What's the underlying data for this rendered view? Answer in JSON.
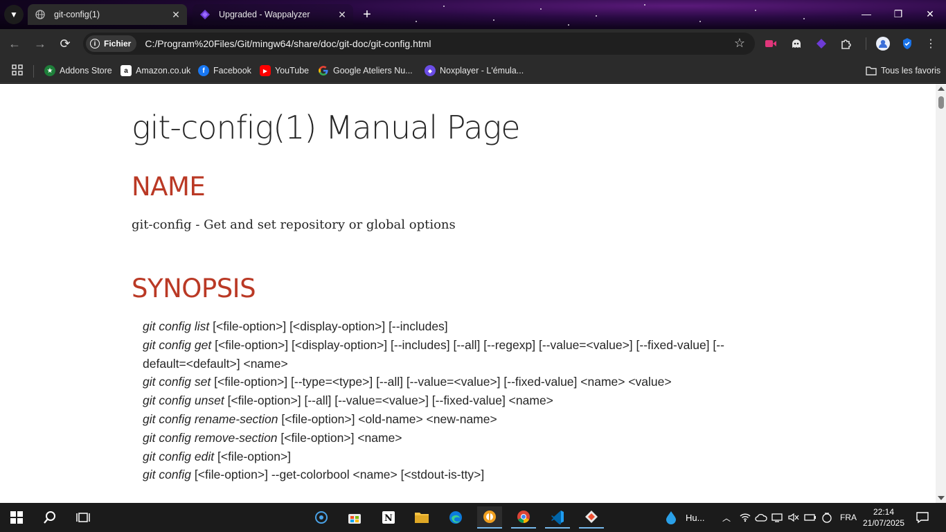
{
  "tabs": [
    {
      "title": "git-config(1)",
      "favicon": "globe-icon",
      "active": true
    },
    {
      "title": "Upgraded - Wappalyzer",
      "favicon": "wappalyzer-icon",
      "active": false
    }
  ],
  "window_controls": {
    "minimize": "—",
    "restore": "❐",
    "close": "✕"
  },
  "toolbar": {
    "security_chip": "Fichier",
    "url": "C:/Program%20Files/Git/mingw64/share/doc/git-doc/git-config.html"
  },
  "bookmarks": {
    "apps_icon": "apps-grid-icon",
    "items": [
      {
        "label": "Addons Store",
        "icon": "addons-store-icon",
        "color": "#1e7f3a"
      },
      {
        "label": "Amazon.co.uk",
        "icon": "amazon-icon",
        "color": "#ffffff"
      },
      {
        "label": "Facebook",
        "icon": "facebook-icon",
        "color": "#1877f2"
      },
      {
        "label": "YouTube",
        "icon": "youtube-icon",
        "color": "#ff0000"
      },
      {
        "label": "Google Ateliers Nu...",
        "icon": "google-icon",
        "color": "#4285f4"
      },
      {
        "label": "Noxplayer - L'émula...",
        "icon": "noxplayer-icon",
        "color": "#6b4de6"
      }
    ],
    "all_bookmarks": "Tous les favoris"
  },
  "page": {
    "title": "git-config(1) Manual Page",
    "name_heading": "NAME",
    "name_text": "git-config - Get and set repository or global options",
    "synopsis_heading": "SYNOPSIS",
    "synopsis": [
      {
        "cmd": "git config list",
        "args": " [<file-option>] [<display-option>] [--includes]"
      },
      {
        "cmd": "git config get",
        "args": " [<file-option>] [<display-option>] [--includes] [--all] [--regexp] [--value=<value>] [--fixed-value] [--default=<default>] <name>"
      },
      {
        "cmd": "git config set",
        "args": " [<file-option>] [--type=<type>] [--all] [--value=<value>] [--fixed-value] <name> <value>"
      },
      {
        "cmd": "git config unset",
        "args": " [<file-option>] [--all] [--value=<value>] [--fixed-value] <name>"
      },
      {
        "cmd": "git config rename-section",
        "args": " [<file-option>] <old-name> <new-name>"
      },
      {
        "cmd": "git config remove-section",
        "args": " [<file-option>] <name>"
      },
      {
        "cmd": "git config edit",
        "args": " [<file-option>]"
      },
      {
        "cmd": "git config",
        "args": " [<file-option>] --get-colorbool <name> [<stdout-is-tty>]"
      }
    ]
  },
  "taskbar": {
    "weather": "Hu...",
    "language": "FRA",
    "time": "22:14",
    "date": "21/07/2025"
  },
  "colors": {
    "heading": "#ba3925",
    "text": "#262626",
    "chrome_bg": "#2b2b2b",
    "taskbar_bg": "#1b1b1b"
  }
}
